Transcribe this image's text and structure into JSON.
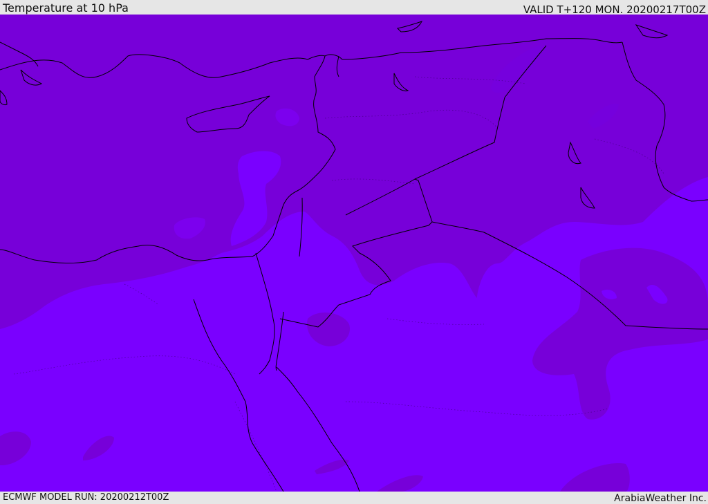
{
  "header": {
    "title": "Temperature at 10 hPa",
    "valid_time": "VALID T+120 MON. 20200217T00Z"
  },
  "footer": {
    "model_run": "ECMWF MODEL RUN: 20200212T00Z",
    "credit": "ArabiaWeather Inc."
  },
  "map": {
    "field": "temperature",
    "level": "10 hPa",
    "colors": {
      "cold_band": "#7700d9",
      "warm_band": "#7a00ff",
      "mid_band": "#7c00ee",
      "coastline": "#000000"
    }
  }
}
